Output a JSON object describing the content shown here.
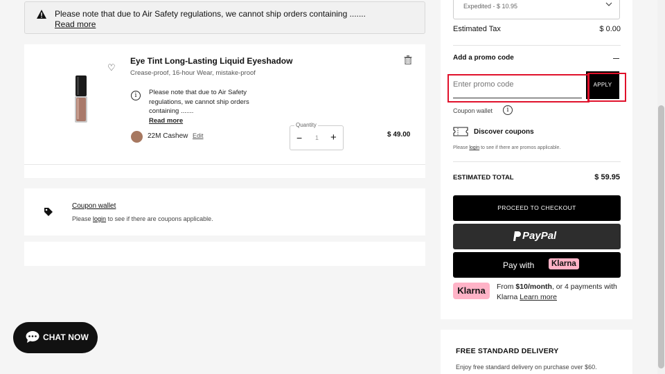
{
  "alert": {
    "message": "Please note that due to Air Safety regulations, we cannot ship orders containing .......",
    "read_more": "Read more"
  },
  "product": {
    "name": "Eye Tint Long-Lasting Liquid Eyeshadow",
    "subtitle": "Crease-proof, 16-hour Wear, mistake-proof",
    "note": "Please note that due to Air Safety regulations, we cannot ship orders containing .......",
    "read_more": "Read more",
    "shade": "22M Cashew",
    "shade_color": "#a77860",
    "edit_label": "Edit",
    "quantity_label": "Quantity",
    "quantity_value": "1",
    "minus": "−",
    "plus": "+",
    "price": "$ 49.00"
  },
  "coupon_wallet": {
    "title": "Coupon wallet",
    "text_before": "Please",
    "login": "login",
    "text_after": "to see if there are coupons applicable."
  },
  "chat": {
    "label": "CHAT NOW"
  },
  "summary": {
    "shipping_selected": "Expedited - $ 10.95",
    "tax_label": "Estimated Tax",
    "tax_value": "$ 0.00",
    "promo_heading": "Add a promo code",
    "promo_placeholder": "Enter promo code",
    "apply_label": "APPLY",
    "coupon_wallet_label": "Coupon wallet",
    "discover_label": "Discover coupons",
    "promo_login_before": "Please",
    "promo_login": "login",
    "promo_login_after": "to see if there are promos applicable.",
    "estimated_total_label": "ESTIMATED TOTAL",
    "estimated_total_value": "$ 59.95",
    "checkout_label": "PROCEED TO CHECKOUT",
    "paypal_label": "PayPal",
    "klarna_pay_label": "Pay with",
    "klarna_brand": "Klarna",
    "klarna_badge": "Klarna",
    "klarna_from": "From",
    "klarna_amount": "$10/month",
    "klarna_rest": ", or 4 payments with Klarna",
    "klarna_learn": "Learn more"
  },
  "delivery": {
    "heading": "FREE STANDARD DELIVERY",
    "text": "Enjoy free standard delivery on purchase over $60."
  },
  "colors": {
    "accent": "#000000",
    "highlight": "#e0102a",
    "klarna_pink": "#ffb3c7",
    "paypal_bg": "#2d2d2d"
  }
}
